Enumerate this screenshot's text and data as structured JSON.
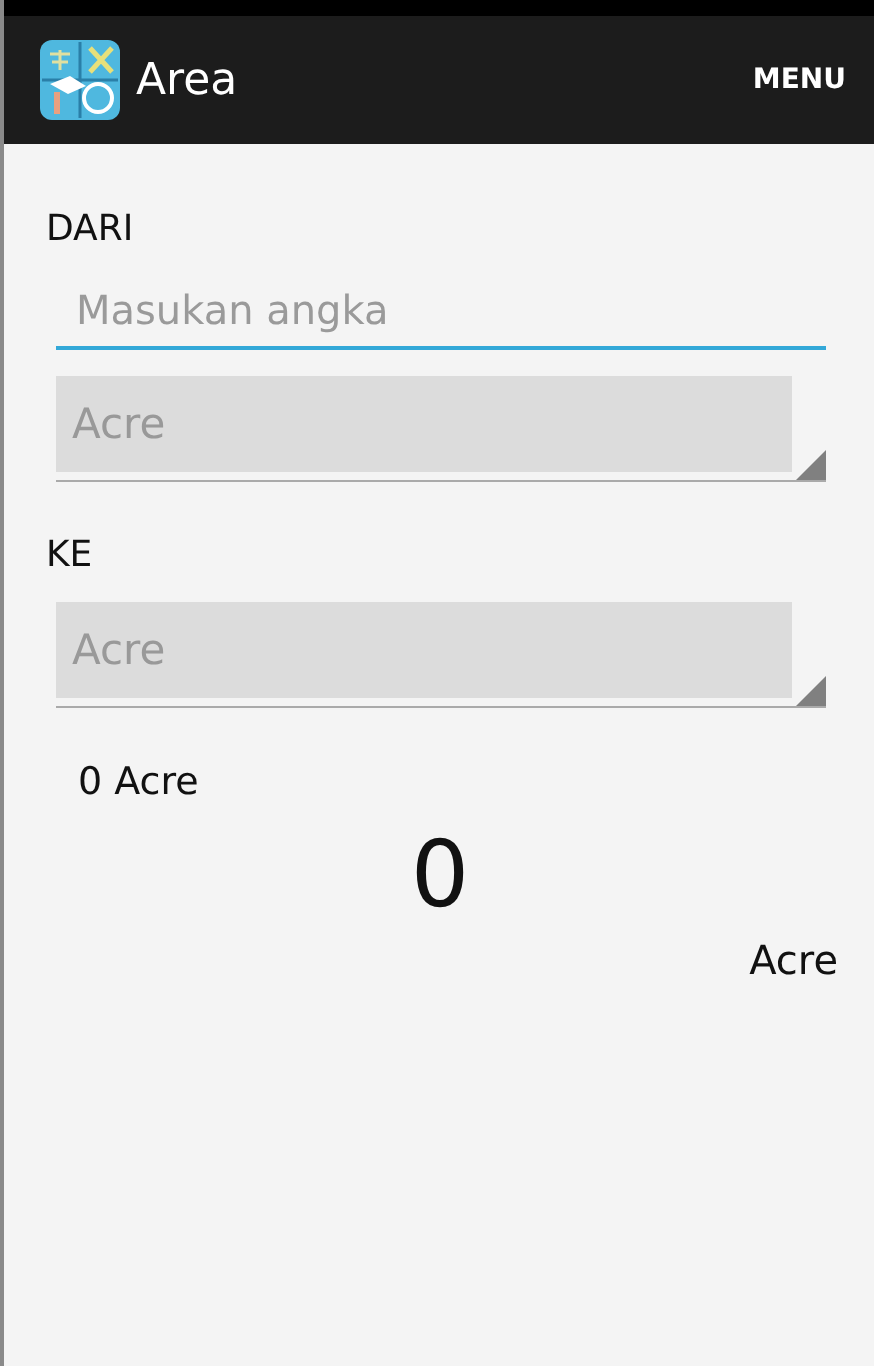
{
  "app_bar": {
    "title": "Area",
    "menu": "MENU"
  },
  "from": {
    "label": "DARI",
    "input": {
      "placeholder": "Masukan angka"
    },
    "unit": "Acre"
  },
  "to": {
    "label": "KE",
    "unit": "Acre"
  },
  "result": {
    "summary": "0 Acre",
    "value": "0",
    "unit": "Acre"
  }
}
